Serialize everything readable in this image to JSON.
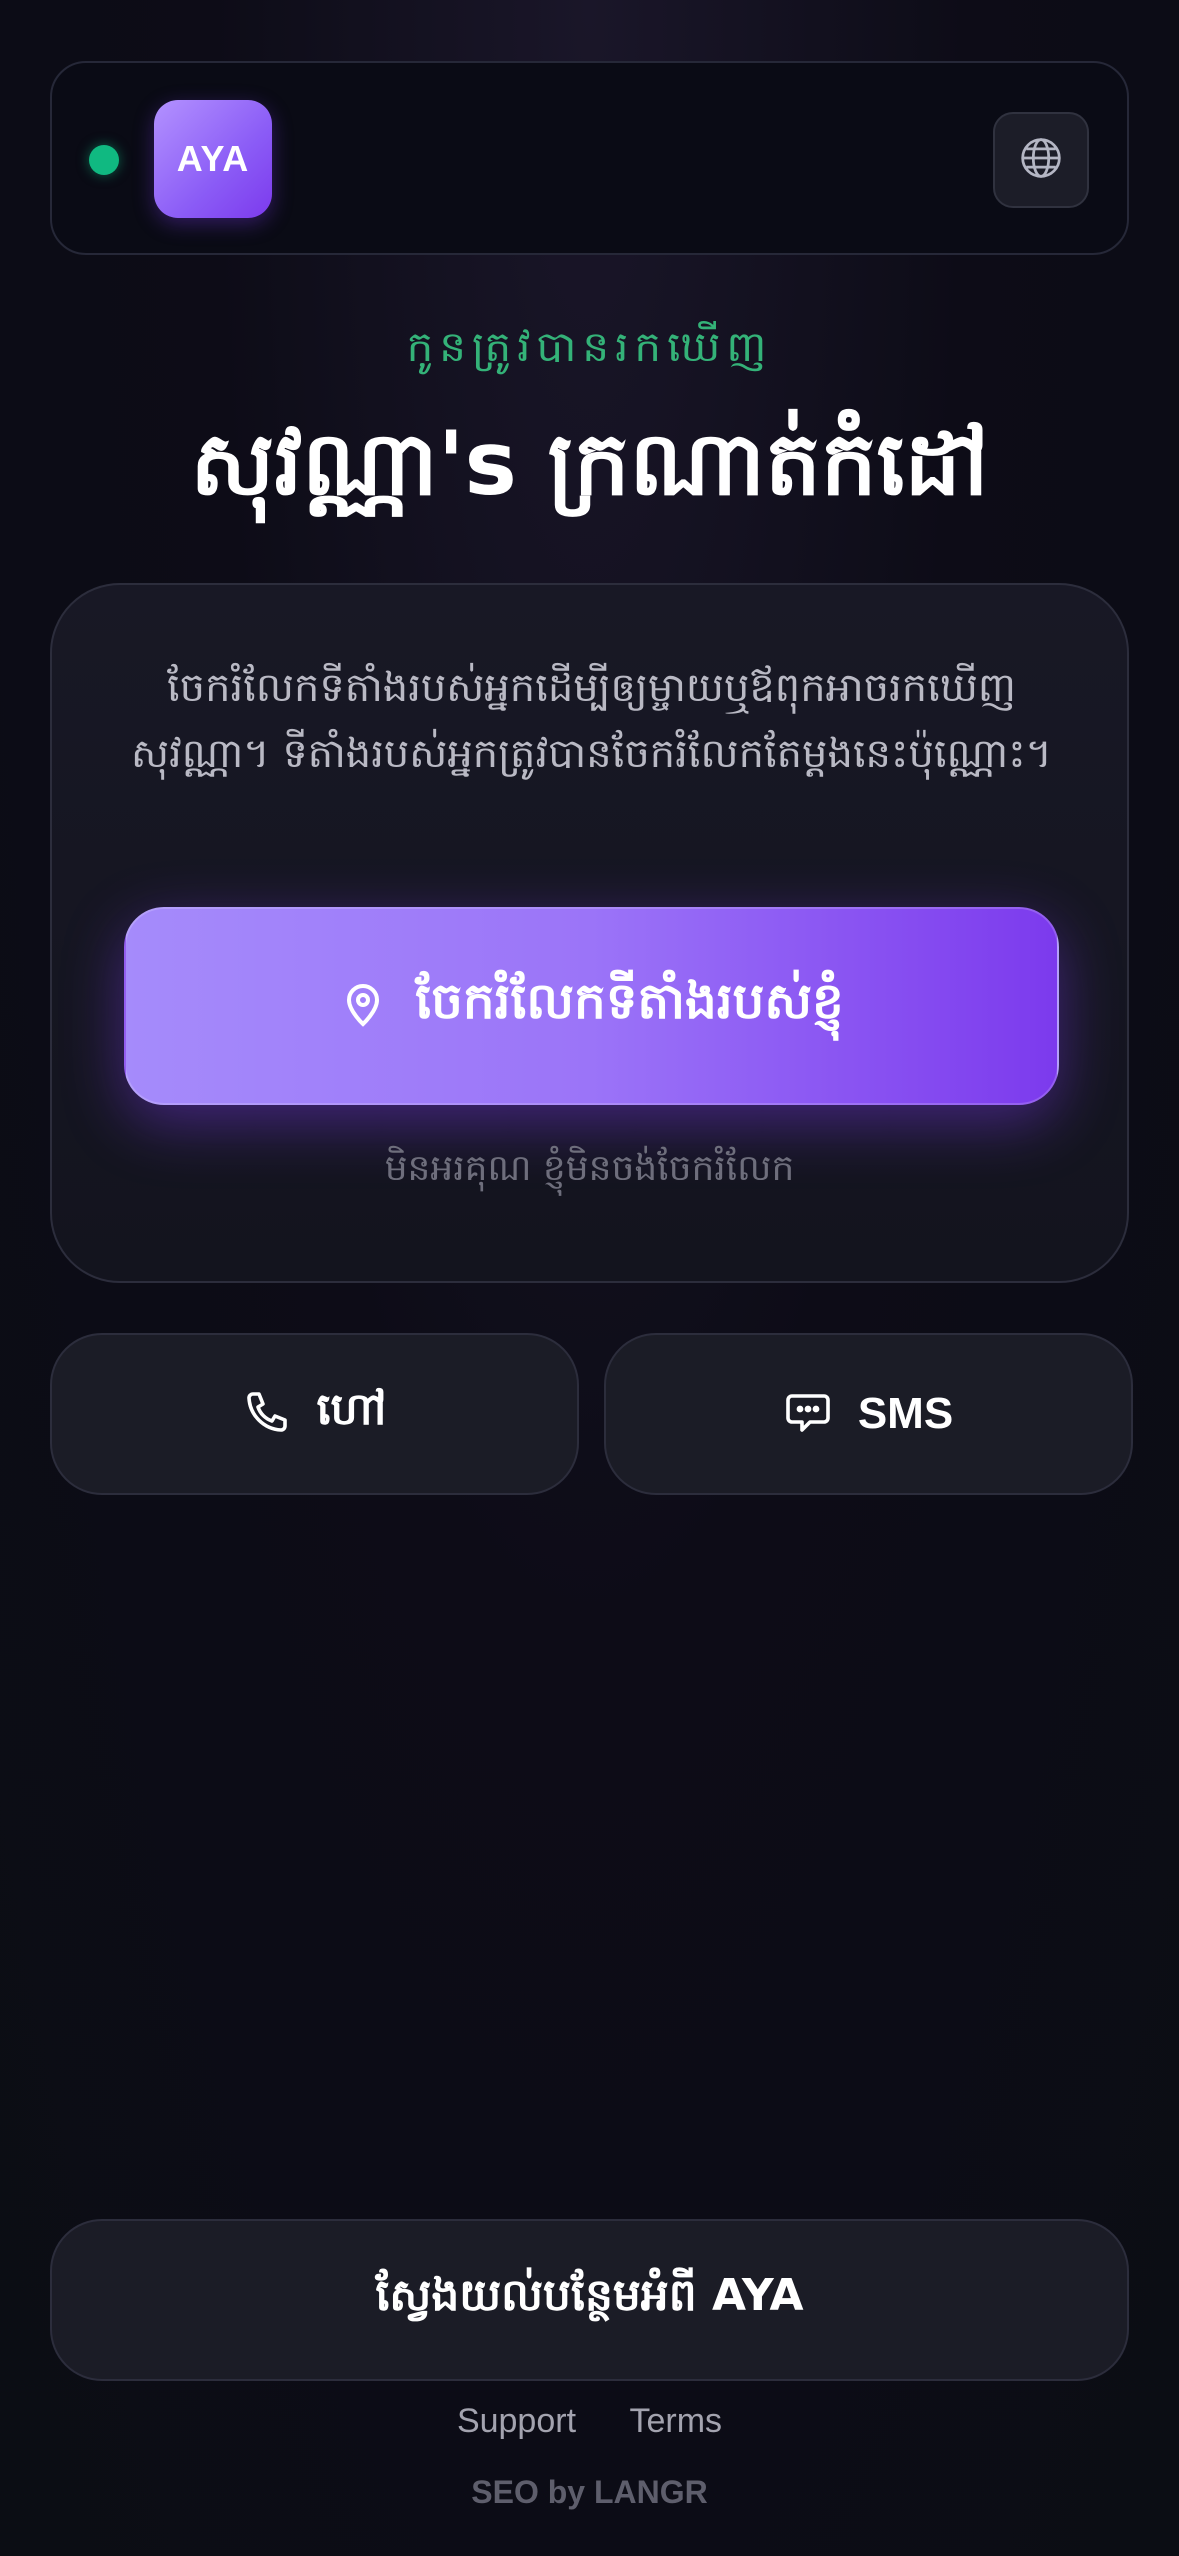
{
  "header": {
    "logo_text": "AYA",
    "status_color": "#10b981",
    "language_icon": "globe-icon"
  },
  "hero": {
    "subtitle": "កូនត្រូវបានរកឃើញ",
    "title": "សុវណ្ណា's ក្រណាត់កំដៅ"
  },
  "card": {
    "description": "ចែករំលែកទីតាំងរបស់អ្នកដើម្បីឲ្យម្ចាយឬឪពុកអាចរកឃើញសុវណ្ណា។ ទីតាំងរបស់អ្នកត្រូវបានចែករំលែកតែម្តងនេះប៉ុណ្ណោះ។",
    "share_button": {
      "label": "ចែករំលែកទីតាំងរបស់ខ្ញុំ",
      "icon": "location-pin-icon"
    },
    "decline_label": "មិនអរគុណ ខ្ញុំមិនចង់ចែករំលែក",
    "accent": "#8b5cf6"
  },
  "actions": {
    "call": {
      "label": "ហៅ",
      "icon": "phone-icon"
    },
    "sms": {
      "label": "SMS",
      "icon": "chat-bubble-icon"
    }
  },
  "learn_more_label": "ស្វែងយល់បន្ថែមអំពី AYA",
  "footer": {
    "support": "Support",
    "terms": "Terms",
    "seo": "SEO by LANGR"
  }
}
